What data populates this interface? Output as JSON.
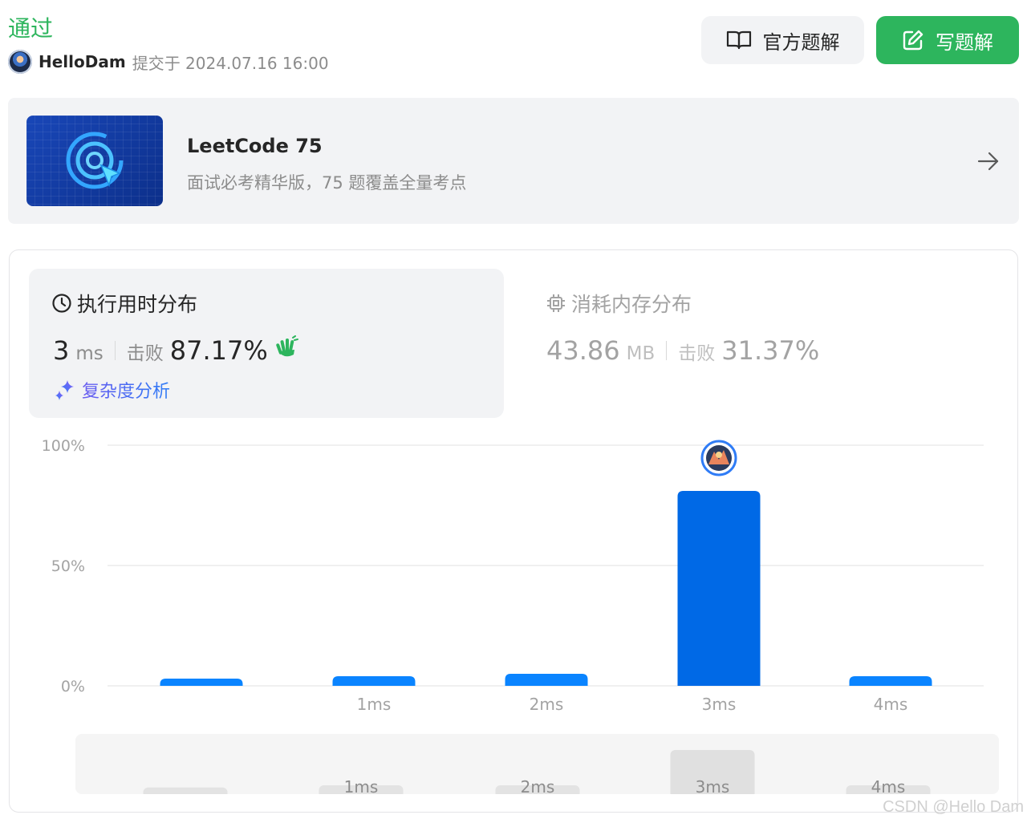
{
  "header": {
    "status": "通过",
    "username": "HelloDam",
    "submitted_text": "提交于 2024.07.16 16:00",
    "official_solution_label": "官方题解",
    "write_solution_label": "写题解"
  },
  "study_plan": {
    "title": "LeetCode 75",
    "subtitle": "面试必考精华版，75 题覆盖全量考点"
  },
  "runtime": {
    "title": "执行用时分布",
    "value": "3",
    "unit": "ms",
    "beat_label": "击败",
    "beat_percent": "87.17%",
    "analysis_label": "复杂度分析"
  },
  "memory": {
    "title": "消耗内存分布",
    "value": "43.86",
    "unit": "MB",
    "beat_label": "击败",
    "beat_percent": "31.37%"
  },
  "colors": {
    "accept_green": "#2db55d",
    "bar_blue": "#0a84ff",
    "bar_highlight": "#0069e6"
  },
  "chart_data": {
    "type": "bar",
    "categories": [
      "",
      "1ms",
      "2ms",
      "3ms",
      "4ms"
    ],
    "values": [
      3,
      4,
      5,
      81,
      4
    ],
    "highlight_index": 3,
    "yticks": [
      "100%",
      "50%",
      "0%"
    ],
    "ylim": [
      0,
      100
    ],
    "overview_values": [
      3,
      4,
      4,
      20,
      4
    ],
    "grid": true
  },
  "watermark": "CSDN @Hello Dam"
}
